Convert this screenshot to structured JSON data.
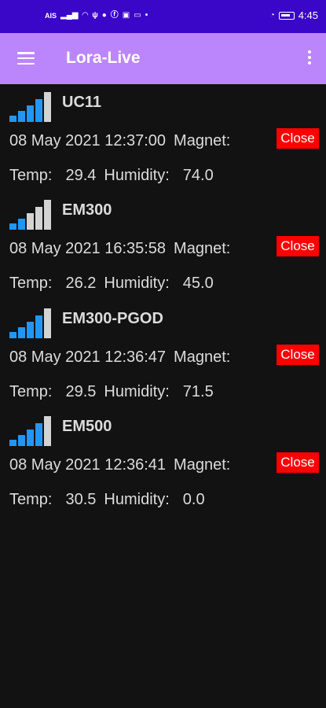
{
  "status_bar": {
    "time": "4:45",
    "network_label": "AIS"
  },
  "app_bar": {
    "title": "Lora-Live"
  },
  "labels": {
    "magnet": "Magnet:",
    "temp": "Temp:",
    "humidity": "Humidity:"
  },
  "colors": {
    "status_bar": "#3a06c8",
    "app_bar": "#bb86fc",
    "signal_active": "#2196f3",
    "signal_inactive": "#d3d3d3",
    "close_button": "#ff0000"
  },
  "devices": [
    {
      "name": "UC11",
      "timestamp": "08 May 2021 12:37:00",
      "magnet_status": "Close",
      "temp": "29.4",
      "humidity": "74.0",
      "signal_bars": 4
    },
    {
      "name": "EM300",
      "timestamp": "08 May 2021 16:35:58",
      "magnet_status": "Close",
      "temp": "26.2",
      "humidity": "45.0",
      "signal_bars": 2
    },
    {
      "name": "EM300-PGOD",
      "timestamp": "08 May 2021 12:36:47",
      "magnet_status": "Close",
      "temp": "29.5",
      "humidity": "71.5",
      "signal_bars": 4
    },
    {
      "name": "EM500",
      "timestamp": "08 May 2021 12:36:41",
      "magnet_status": "Close",
      "temp": "30.5",
      "humidity": "0.0",
      "signal_bars": 4
    }
  ]
}
